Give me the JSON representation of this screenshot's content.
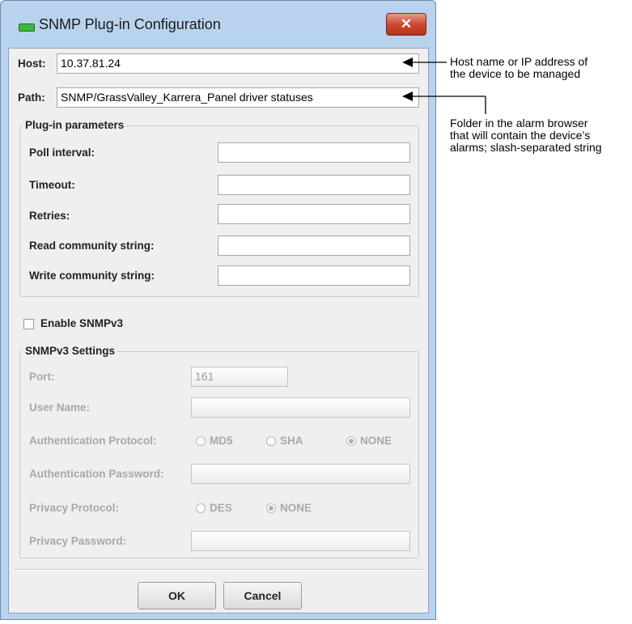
{
  "window": {
    "title": "SNMP Plug-in Configuration",
    "close_label": "✕"
  },
  "host": {
    "label": "Host:",
    "value": "10.37.81.24"
  },
  "path": {
    "label": "Path:",
    "value": "SNMP/GrassValley_Karrera_Panel driver statuses"
  },
  "plugin_params": {
    "legend": "Plug-in parameters",
    "poll_label": "Poll interval:",
    "timeout_label": "Timeout:",
    "retries_label": "Retries:",
    "read_label": "Read community string:",
    "write_label": "Write community string:"
  },
  "snmpv3": {
    "enable_label": "Enable SNMPv3",
    "enabled": false,
    "legend": "SNMPv3 Settings",
    "port_label": "Port:",
    "port_value": "161",
    "user_label": "User Name:",
    "auth_protocol_label": "Authentication Protocol:",
    "auth_options": [
      "MD5",
      "SHA",
      "NONE"
    ],
    "auth_selected": "NONE",
    "auth_password_label": "Authentication Password:",
    "privacy_protocol_label": "Privacy Protocol:",
    "privacy_options": [
      "DES",
      "NONE"
    ],
    "privacy_selected": "NONE",
    "privacy_password_label": "Privacy Password:"
  },
  "buttons": {
    "ok": "OK",
    "cancel": "Cancel"
  },
  "annotations": {
    "host_line1": "Host name or IP address of",
    "host_line2": "the device to be managed",
    "path_line1": "Folder in the alarm browser",
    "path_line2": "that will contain the device’s",
    "path_line3": "alarms; slash-separated string"
  },
  "colors": {
    "title_bar": "#b9d3ee",
    "close_button": "#cc4a31",
    "dialog_bg": "#efefef"
  }
}
